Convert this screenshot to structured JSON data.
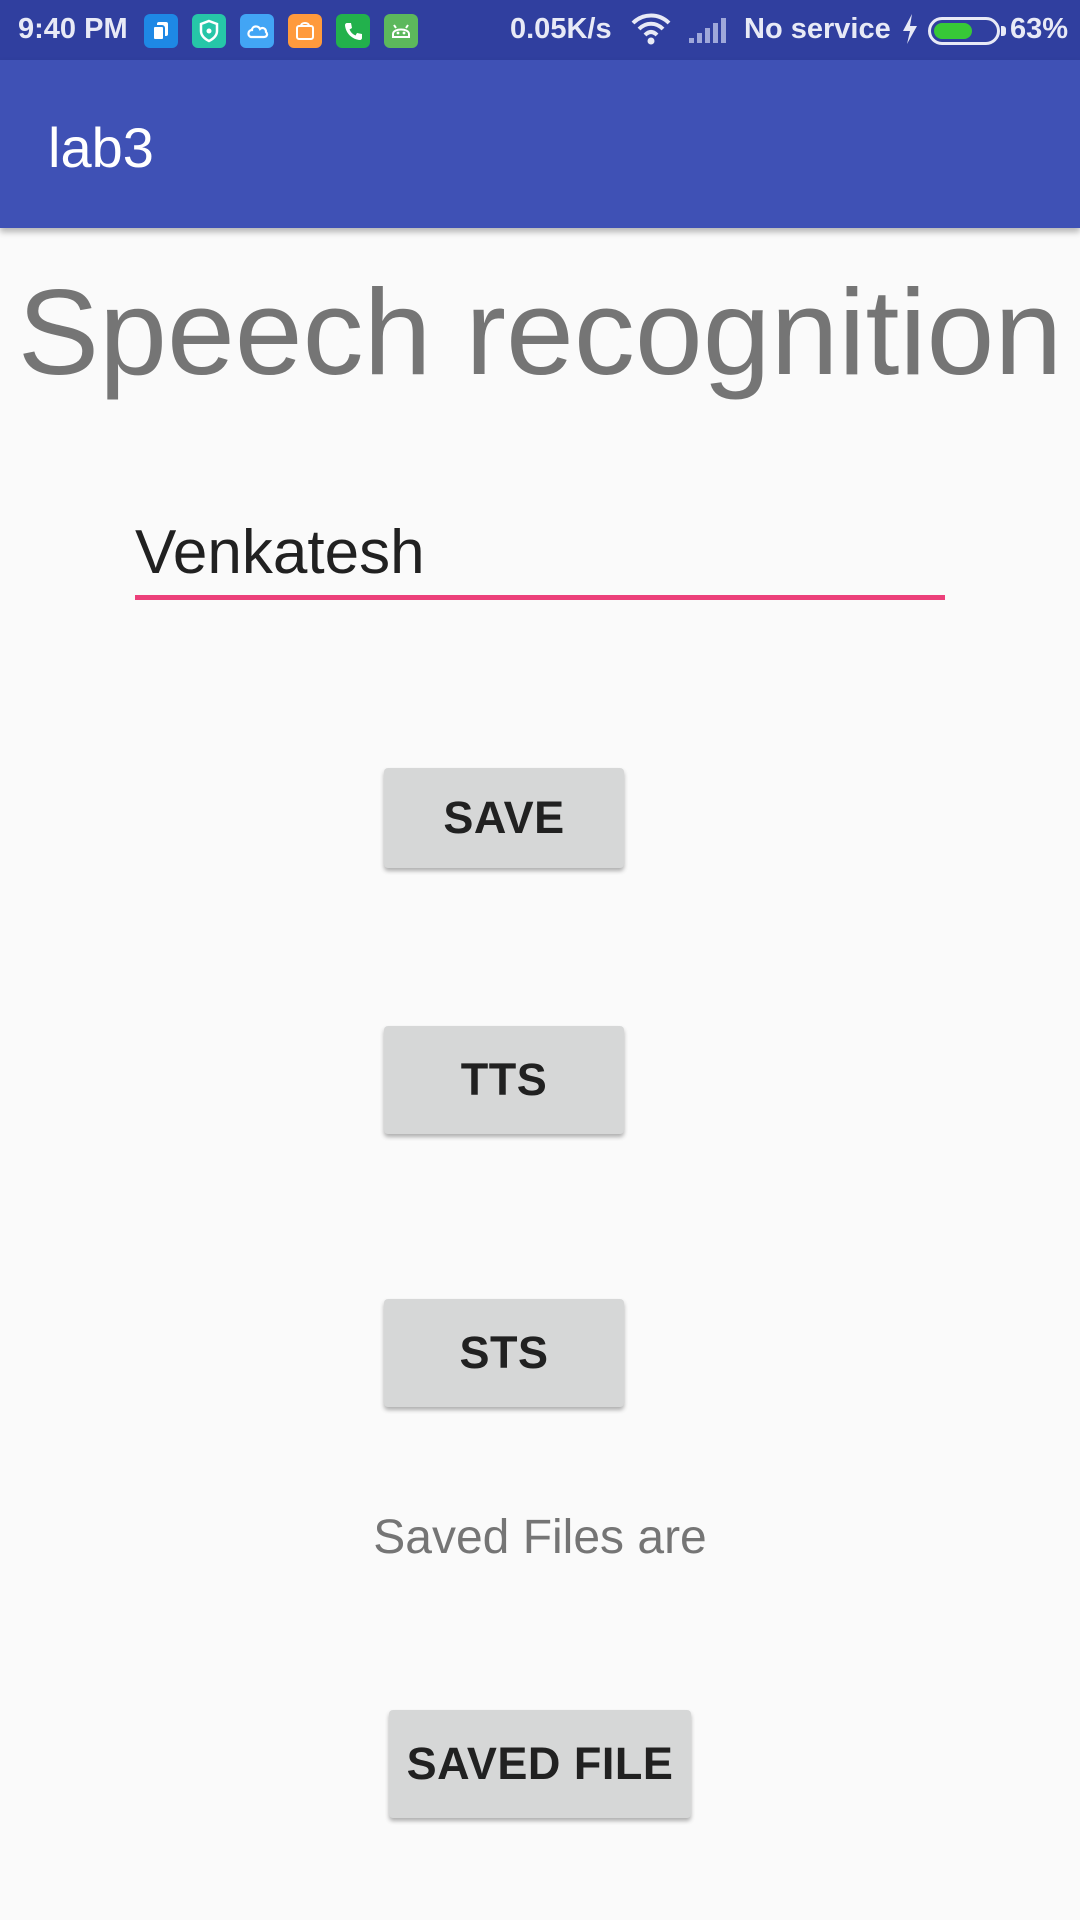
{
  "status_bar": {
    "time": "9:40 PM",
    "net_speed": "0.05K/s",
    "service": "No service",
    "battery_percent": "63%",
    "battery_level": 0.63,
    "notification_icons": [
      "copy-icon",
      "shield-icon",
      "cloud-icon",
      "mi-store-icon",
      "phone-icon",
      "android-icon"
    ]
  },
  "app_bar": {
    "title": "lab3"
  },
  "main": {
    "heading": "Speech recognition",
    "input_value": "Venkatesh",
    "save_label": "SAVE",
    "tts_label": "TTS",
    "sts_label": "STS",
    "saved_files_label": "Saved Files are",
    "saved_file_label": "SAVED FILE"
  },
  "colors": {
    "status_bar": "#303f9f",
    "app_bar": "#3f51b5",
    "accent": "#ec407a",
    "button": "#d6d7d7"
  }
}
